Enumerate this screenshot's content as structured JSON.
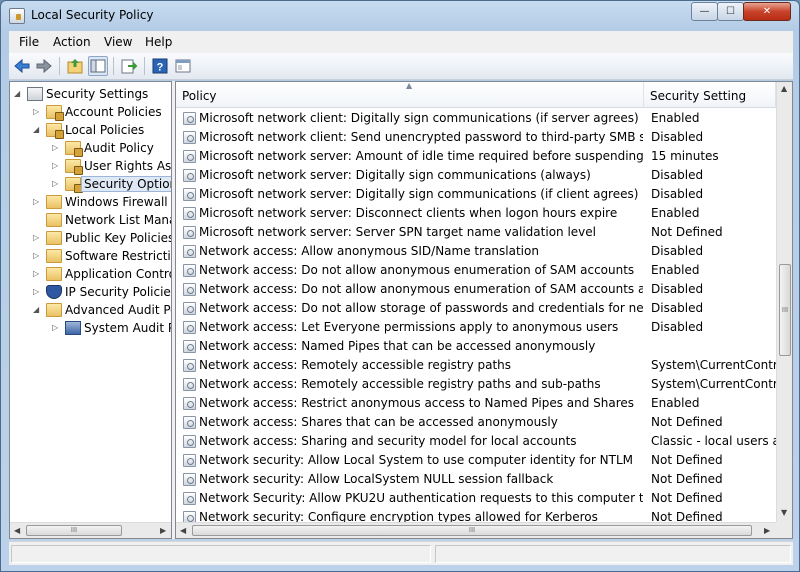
{
  "window": {
    "title": "Local Security Policy",
    "controls": {
      "minimize": "—",
      "maximize": "☐",
      "close": "✕"
    }
  },
  "menu": [
    "File",
    "Action",
    "View",
    "Help"
  ],
  "toolbar": [
    "back-icon",
    "forward-icon",
    "up-folder-icon",
    "show-hide-tree-icon",
    "export-list-icon",
    "help-icon",
    "properties-icon"
  ],
  "tree": {
    "items": [
      {
        "label": "Security Settings",
        "level": 0,
        "icon": "root-icon",
        "expander": "◢"
      },
      {
        "label": "Account Policies",
        "level": 1,
        "icon": "folder-lock-icon",
        "expander": "▷"
      },
      {
        "label": "Local Policies",
        "level": 1,
        "icon": "folder-lock-icon",
        "expander": "◢"
      },
      {
        "label": "Audit Policy",
        "level": 2,
        "icon": "folder-lock-icon",
        "expander": "▷"
      },
      {
        "label": "User Rights Assignment",
        "level": 2,
        "icon": "folder-lock-icon",
        "expander": "▷"
      },
      {
        "label": "Security Options",
        "level": 2,
        "icon": "folder-lock-icon",
        "expander": "▷",
        "selected": true
      },
      {
        "label": "Windows Firewall with Advanced Security",
        "level": 1,
        "icon": "folder-icon",
        "expander": "▷"
      },
      {
        "label": "Network List Manager Policies",
        "level": 1,
        "icon": "folder-icon",
        "expander": ""
      },
      {
        "label": "Public Key Policies",
        "level": 1,
        "icon": "folder-icon",
        "expander": "▷"
      },
      {
        "label": "Software Restriction Policies",
        "level": 1,
        "icon": "folder-icon",
        "expander": "▷"
      },
      {
        "label": "Application Control Policies",
        "level": 1,
        "icon": "folder-icon",
        "expander": "▷"
      },
      {
        "label": "IP Security Policies on Local Computer",
        "level": 1,
        "icon": "shield-icon",
        "expander": "▷"
      },
      {
        "label": "Advanced Audit Policy Configuration",
        "level": 1,
        "icon": "folder-icon",
        "expander": "◢"
      },
      {
        "label": "System Audit Policies",
        "level": 2,
        "icon": "audit-icon",
        "expander": "▷"
      }
    ]
  },
  "list": {
    "columns": [
      "Policy",
      "Security Setting"
    ],
    "rows": [
      {
        "policy": "Microsoft network client: Digitally sign communications (if server agrees)",
        "setting": "Enabled"
      },
      {
        "policy": "Microsoft network client: Send unencrypted password to third-party SMB servers",
        "setting": "Disabled"
      },
      {
        "policy": "Microsoft network server: Amount of idle time required before suspending session",
        "setting": "15 minutes"
      },
      {
        "policy": "Microsoft network server: Digitally sign communications (always)",
        "setting": "Disabled"
      },
      {
        "policy": "Microsoft network server: Digitally sign communications (if client agrees)",
        "setting": "Disabled"
      },
      {
        "policy": "Microsoft network server: Disconnect clients when logon hours expire",
        "setting": "Enabled"
      },
      {
        "policy": "Microsoft network server: Server SPN target name validation level",
        "setting": "Not Defined"
      },
      {
        "policy": "Network access: Allow anonymous SID/Name translation",
        "setting": "Disabled"
      },
      {
        "policy": "Network access: Do not allow anonymous enumeration of SAM accounts",
        "setting": "Enabled"
      },
      {
        "policy": "Network access: Do not allow anonymous enumeration of SAM accounts and shares",
        "setting": "Disabled"
      },
      {
        "policy": "Network access: Do not allow storage of passwords and credentials for network au...",
        "setting": "Disabled"
      },
      {
        "policy": "Network access: Let Everyone permissions apply to anonymous users",
        "setting": "Disabled"
      },
      {
        "policy": "Network access: Named Pipes that can be accessed anonymously",
        "setting": ""
      },
      {
        "policy": "Network access: Remotely accessible registry paths",
        "setting": "System\\CurrentControl"
      },
      {
        "policy": "Network access: Remotely accessible registry paths and sub-paths",
        "setting": "System\\CurrentControl"
      },
      {
        "policy": "Network access: Restrict anonymous access to Named Pipes and Shares",
        "setting": "Enabled"
      },
      {
        "policy": "Network access: Shares that can be accessed anonymously",
        "setting": "Not Defined"
      },
      {
        "policy": "Network access: Sharing and security model for local accounts",
        "setting": "Classic - local users auth"
      },
      {
        "policy": "Network security: Allow Local System to use computer identity for NTLM",
        "setting": "Not Defined"
      },
      {
        "policy": "Network security: Allow LocalSystem NULL session fallback",
        "setting": "Not Defined"
      },
      {
        "policy": "Network Security: Allow PKU2U authentication requests to this computer to use on...",
        "setting": "Not Defined"
      },
      {
        "policy": "Network security: Configure encryption types allowed for Kerberos",
        "setting": "Not Defined"
      }
    ]
  },
  "scroll": {
    "grip": "III",
    "up": "▲",
    "down": "▼",
    "left": "◀",
    "right": "▶"
  },
  "colors": {
    "selection": "#dfe9f5",
    "titlebar": "#b9d1ea",
    "close": "#c8432a"
  }
}
